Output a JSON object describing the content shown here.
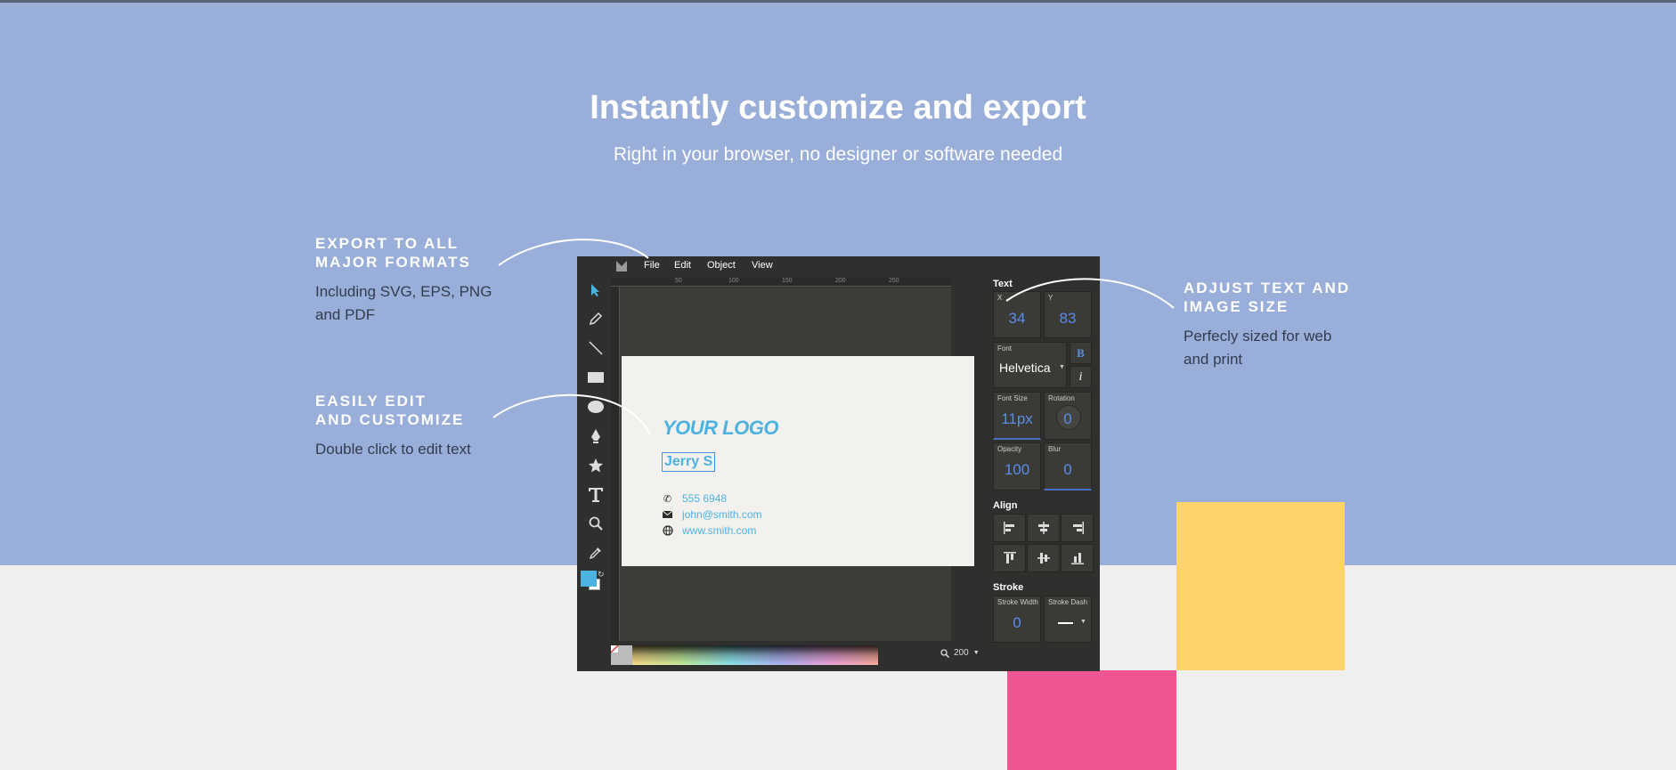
{
  "hero": {
    "title": "Instantly customize and export",
    "subtitle": "Right in your browser, no designer or software needed"
  },
  "features": {
    "export": {
      "heading_line1": "EXPORT TO ALL",
      "heading_line2": "MAJOR FORMATS",
      "desc_line1": "Including SVG, EPS, PNG",
      "desc_line2": "and PDF"
    },
    "edit": {
      "heading_line1": "EASILY EDIT",
      "heading_line2": "AND CUSTOMIZE",
      "desc_line1": "Double click to edit text"
    },
    "adjust": {
      "heading_line1": "ADJUST TEXT AND",
      "heading_line2": "IMAGE SIZE",
      "desc_line1": "Perfecly sized for web",
      "desc_line2": "and print"
    }
  },
  "editor": {
    "menu": [
      "File",
      "Edit",
      "Object",
      "View"
    ],
    "ruler_ticks": [
      "50",
      "100",
      "150",
      "200",
      "250"
    ],
    "tools": [
      "select-arrow-icon",
      "pencil-icon",
      "line-icon",
      "rectangle-icon",
      "ellipse-icon",
      "pen-icon",
      "star-icon",
      "text-icon",
      "zoom-icon",
      "eyedropper-icon"
    ],
    "card": {
      "logo": "YOUR LOGO",
      "name": "Jerry S",
      "phone": "555 6948",
      "email": "john@smith.com",
      "website": "www.smith.com"
    },
    "zoom_value": "200",
    "colors": {
      "accent": "#4cb2e0",
      "fill_swatch": "#4cb2e0",
      "panel_value": "#5a8de8"
    },
    "panel": {
      "text_title": "Text",
      "x_label": "X",
      "x_value": "34",
      "y_label": "Y",
      "y_value": "83",
      "font_label": "Font",
      "font_value": "Helvetica",
      "bold_label": "B",
      "italic_label": "i",
      "font_size_label": "Font Size",
      "font_size_value": "11px",
      "rotation_label": "Rotation",
      "rotation_value": "0",
      "opacity_label": "Opacity",
      "opacity_value": "100",
      "blur_label": "Blur",
      "blur_value": "0",
      "align_title": "Align",
      "stroke_title": "Stroke",
      "stroke_width_label": "Stroke Width",
      "stroke_width_value": "0",
      "stroke_dash_label": "Stroke Dash"
    }
  }
}
